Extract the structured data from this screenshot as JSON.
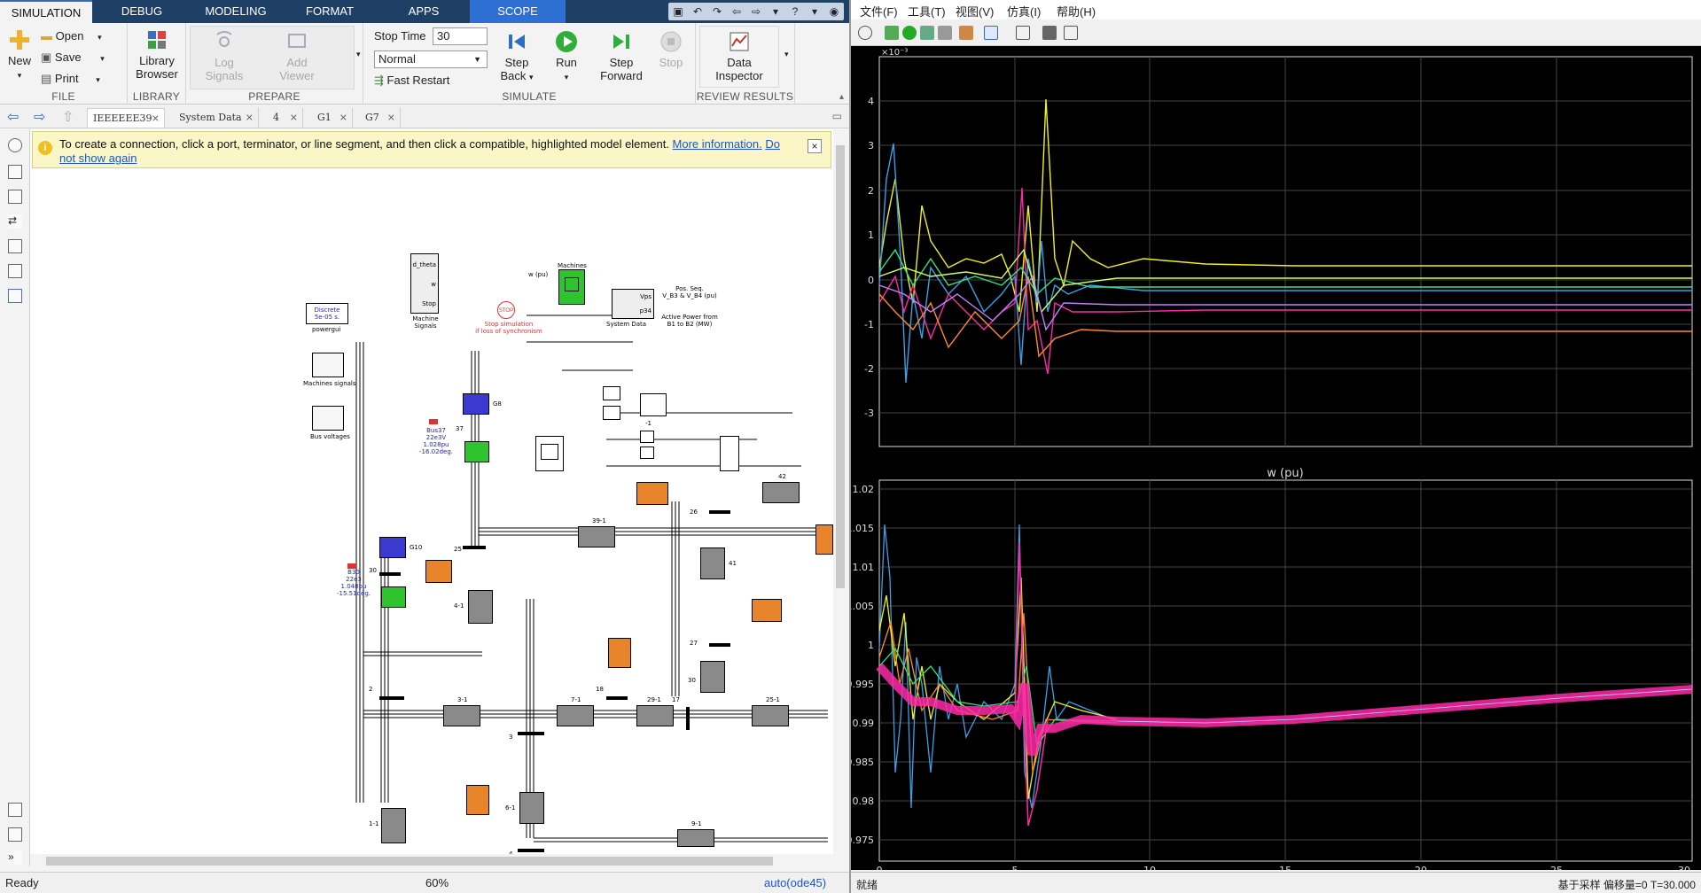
{
  "ribbon_tabs": [
    {
      "label": "SIMULATION",
      "active": true
    },
    {
      "label": "DEBUG"
    },
    {
      "label": "MODELING"
    },
    {
      "label": "FORMAT"
    },
    {
      "label": "APPS"
    },
    {
      "label": "SCOPE",
      "special": true
    }
  ],
  "file": {
    "new": "New",
    "open": "Open",
    "save": "Save",
    "print": "Print",
    "group": "FILE"
  },
  "library": {
    "browser_line1": "Library",
    "browser_line2": "Browser",
    "group": "LIBRARY"
  },
  "prepare": {
    "log_line1": "Log",
    "log_line2": "Signals",
    "add_line1": "Add",
    "add_line2": "Viewer",
    "group": "PREPARE"
  },
  "simulate": {
    "stop_time_label": "Stop Time",
    "stop_time_value": "30",
    "mode": "Normal",
    "fast_restart": "Fast Restart",
    "step_back_line1": "Step",
    "step_back_line2": "Back",
    "run": "Run",
    "step_fwd_line1": "Step",
    "step_fwd_line2": "Forward",
    "stop": "Stop",
    "group": "SIMULATE"
  },
  "review": {
    "data_line1": "Data",
    "data_line2": "Inspector",
    "group": "REVIEW RESULTS"
  },
  "browser_tabs": [
    "IEEEEEE39",
    "System Data",
    "4",
    "G1",
    "G7"
  ],
  "info_bar": {
    "text": "To create a connection, click a port, terminator, or line segment, and then click a compatible, highlighted model element. ",
    "link1": "More information.",
    "link2a": "Do",
    "link2b": "not show again"
  },
  "model": {
    "machines": "Machines",
    "d_theta": "d_theta",
    "w": "w",
    "stop_port": "Stop",
    "w_pu": "w (pu)",
    "machine_signals_1": "Machine",
    "machine_signals_2": "Signals",
    "stop_sign": "STOP",
    "stop_sim_1": "Stop simulation",
    "stop_sim_2": "if loss of synchronism",
    "vps": "Vps",
    "p34": "p34",
    "system_data": "System Data",
    "pos_seq_1": "Pos. Seq.",
    "pos_seq_2": "V_B3 & V_B4 (pu)",
    "active_power_1": "Active Power from",
    "active_power_2": "B1 to B2 (MW)",
    "discrete_1": "Discrete",
    "discrete_2": "5e-05 s.",
    "powergui": "powergui",
    "machines_signals": "Machines signals",
    "bus_voltages": "Bus voltages",
    "bus37": [
      "Bus37",
      "22e3V",
      "1.028pu",
      "-16.02deg."
    ],
    "b30": [
      "B30",
      "22e3",
      "1.048pu",
      "-15.51deg."
    ],
    "g8": "G8",
    "g10": "G10",
    "n37": "37",
    "n25": "25",
    "n30": "30",
    "n41": "41",
    "n1": "-1",
    "n4": "4-1",
    "n2": "2",
    "n391": "39-1",
    "n26": "26",
    "n42": "42",
    "n27": "27",
    "n18": "18",
    "n30b": "30",
    "n17": "17",
    "n31": "3-1",
    "n71": "7-1",
    "n291": "29-1",
    "n251": "25-1",
    "n3": "3",
    "n61": "6-1",
    "n11": "1-1",
    "n91": "9-1",
    "n4b": "4"
  },
  "status": {
    "ready": "Ready",
    "zoom": "60%",
    "solver": "auto(ode45)"
  },
  "scope": {
    "menu": [
      "文件(F)",
      "工具(T)",
      "视图(V)",
      "仿真(I)",
      "帮助(H)"
    ],
    "top_exp": "×10⁻³",
    "top_yticks": [
      "4",
      "3",
      "2",
      "1",
      "0",
      "-1",
      "-2",
      "-3"
    ],
    "bot_title": "w (pu)",
    "bot_yticks": [
      "1.02",
      "1.015",
      "1.01",
      "1.005",
      "1",
      "0.995",
      "0.99",
      "0.985",
      "0.98",
      "0.975"
    ],
    "xticks": [
      "0",
      "5",
      "10",
      "15",
      "20",
      "25",
      "30"
    ],
    "status_left": "就绪",
    "status_right": "基于采样  偏移量=0  T=30.000"
  },
  "colors": {
    "tab_bar": "#1e3f66",
    "scope_tab": "#2e6fd3",
    "block_gray": "#8a8a8a",
    "block_orange": "#e8842a",
    "block_green": "#2fc32f",
    "block_blue": "#3a3ad0",
    "plot_bg": "#000000",
    "magenta": "#ff2aa8",
    "yellow": "#f2f21a",
    "cyan": "#3aa0e8"
  }
}
